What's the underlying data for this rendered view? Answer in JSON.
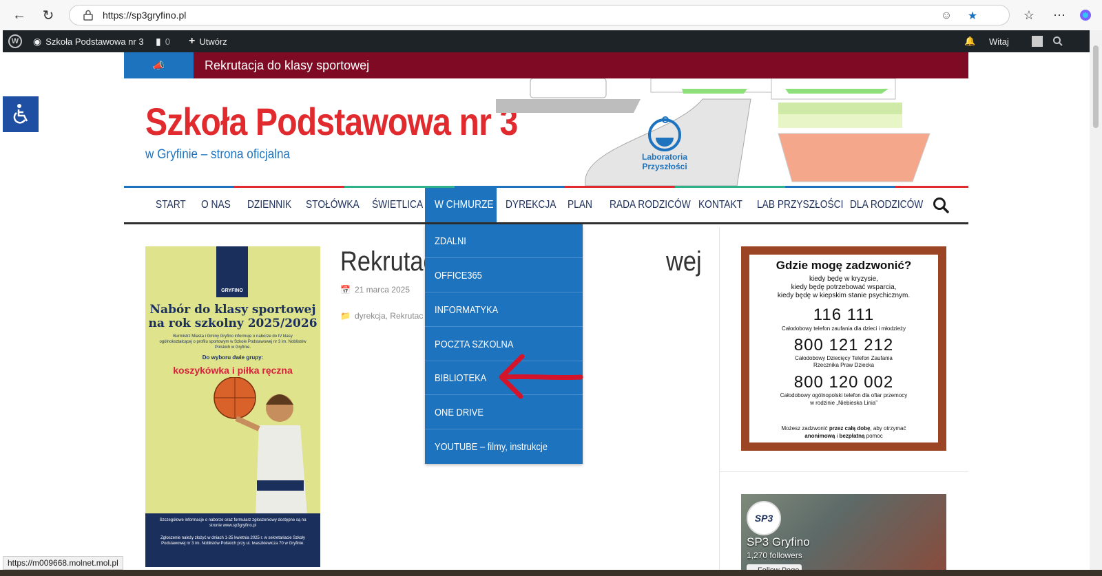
{
  "browser": {
    "url": "https://sp3gryfino.pl"
  },
  "wpbar": {
    "site_name": "Szkoła Podstawowa nr 3",
    "comments_count": "0",
    "new_label": "Utwórz",
    "greeting": "Witaj"
  },
  "ticker": {
    "text": "Rekrutacja do klasy sportowej"
  },
  "header": {
    "title": "Szkoła Podstawowa nr 3",
    "description": "w Gryfinie – strona oficjalna",
    "lab_line1": "Laboratoria",
    "lab_line2": "Przyszłości"
  },
  "nav": {
    "items": [
      {
        "label": "START"
      },
      {
        "label": "O NAS"
      },
      {
        "label": "DZIENNIK"
      },
      {
        "label": "STOŁÓWKA"
      },
      {
        "label": "ŚWIETLICA"
      },
      {
        "label": "W CHMURZE"
      },
      {
        "label": "DYREKCJA"
      },
      {
        "label": "PLAN"
      },
      {
        "label": "RADA RODZICÓW"
      },
      {
        "label": "KONTAKT"
      },
      {
        "label": "LAB PRZYSZŁOŚCI"
      },
      {
        "label": "DLA RODZICÓW"
      }
    ],
    "active_index": 5
  },
  "dropdown": {
    "items": [
      {
        "label": "ZDALNI"
      },
      {
        "label": "OFFICE365"
      },
      {
        "label": "INFORMATYKA"
      },
      {
        "label": "POCZTA SZKOLNA"
      },
      {
        "label": "BIBLIOTEKA"
      },
      {
        "label": "ONE DRIVE"
      },
      {
        "label": "YOUTUBE – filmy, instrukcje"
      }
    ]
  },
  "post": {
    "title_left": "Rekrutac",
    "title_right": "wej",
    "date": "21 marca 2025",
    "categories": "dyrekcja, Rekrutac"
  },
  "poster": {
    "badge": "GRYFINO",
    "heading": "Nabór do klasy sportowej na rok szkolny 2025/2026",
    "intro": "Burmistrz Miasta i Gminy Gryfino informuje o naborze do IV klasy ogólnokształcącej o profilu sportowym w Szkole Podstawowej nr 3 im. Noblistów Polskich w Gryfinie.",
    "choice": "Do wyboru dwie grupy:",
    "sports": "koszykówka i piłka ręczna",
    "info": "Szczegółowe informacje o naborze oraz formularz zgłoszeniowy dostępne są na stronie www.sp3gryfino.pl",
    "deadline": "Zgłoszenie należy złożyć w dniach 1-25 kwietnia 2025 r. w sekretariacie Szkoły Podstawowej nr 3 im. Noblistów Polskich przy ul. Iwaszkiewicza 70 w Gryfinie."
  },
  "helpline": {
    "title": "Gdzie mogę zadzwonić?",
    "sub1": "kiedy będę w kryzysie,",
    "sub2": "kiedy będę potrzebować wsparcia,",
    "sub3": "kiedy będę w kiepskim stanie psychicznym.",
    "num1": "116 111",
    "desc1": "Całodobowy telefon zaufania dla dzieci i młodzieży",
    "num2": "800 121 212",
    "desc2a": "Całodobowy Dziecięcy Telefon Zaufania",
    "desc2b": "Rzecznika Praw Dziecka",
    "num3": "800 120 002",
    "desc3a": "Całodobowy ogólnopolski telefon dla ofiar przemocy",
    "desc3b": "w rodzinie „Niebieska Linia”",
    "footer_pre": "Możesz zadzwonić ",
    "footer_bold1": "przez całą dobę",
    "footer_mid": ", aby otrzymać",
    "footer_bold2": "anonimową",
    "footer_and": " i ",
    "footer_bold3": "bezpłatną",
    "footer_end": " pomoc"
  },
  "facebook": {
    "avatar_text": "SP3",
    "name": "SP3 Gryfino",
    "followers": "1,270 followers",
    "follow_label": "Follow Page"
  },
  "statusbar": {
    "link": "https://m009668.molnet.mol.pl"
  },
  "colors": {
    "accent_blue": "#1e73be",
    "title_red": "#e02a2e",
    "ticker_bg": "#7f0a23",
    "nav_text": "#1b2e5a"
  }
}
